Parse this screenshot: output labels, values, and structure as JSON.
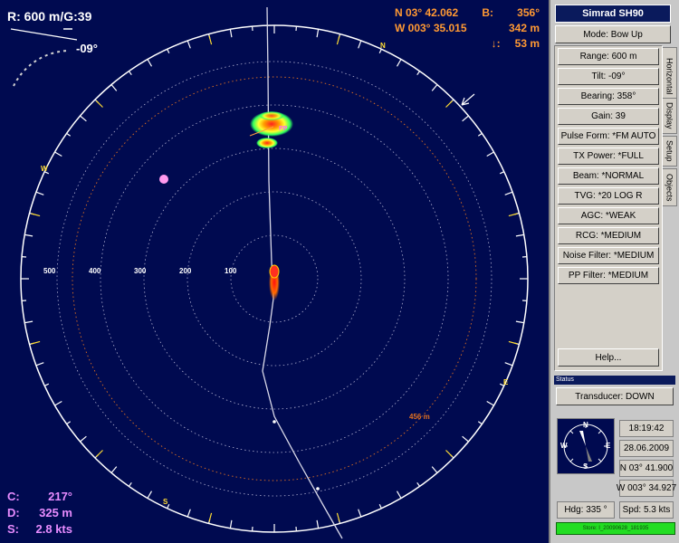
{
  "display": {
    "range_text": "R:  600 m/G:39",
    "tilt_text": "-09°",
    "position": {
      "lat": "N  03° 42.062",
      "bearing_label": "B:",
      "bearing_value": "356°",
      "lon": "W 003° 35.015",
      "distance_value": "342 m",
      "depth_symbol": "↓:",
      "depth_value": "53 m"
    },
    "course": [
      {
        "label": "C:",
        "value": "217°"
      },
      {
        "label": "D:",
        "value": "325 m"
      },
      {
        "label": "S:",
        "value": "2.8 kts"
      }
    ],
    "range_labels": [
      "500",
      "400",
      "300",
      "200",
      "100"
    ],
    "compass_labels": {
      "n": "N",
      "e": "E",
      "s": "S",
      "w": "W"
    },
    "target_distance": "456 m",
    "target_marker": "PP",
    "colors": {
      "background": "#000a50",
      "ring": "#ffffff",
      "position_text": "#ff9933",
      "course_text": "#e88cff",
      "tick": "#ffdd33"
    }
  },
  "panel": {
    "title": "Simrad SH90",
    "mode_button": "Mode: Bow Up",
    "menu_items": [
      "Range: 600 m",
      "Tilt: -09°",
      "Bearing: 358°",
      "Gain: 39",
      "Pulse Form: *FM AUTO",
      "TX Power: *FULL",
      "Beam: *NORMAL",
      "TVG: *20 LOG R",
      "AGC: *WEAK",
      "RCG: *MEDIUM",
      "Noise Filter: *MEDIUM",
      "PP Filter: *MEDIUM"
    ],
    "help_button": "Help...",
    "tabs": [
      "Horizontal",
      "Display",
      "Setup",
      "Objects"
    ],
    "status_label": "Status",
    "transducer_button": "Transducer: DOWN",
    "time": "18:19:42",
    "date": "28.06.2009",
    "lat": "N 03° 41.900",
    "lon": "W 003° 34.927",
    "compass_labels": {
      "n": "N",
      "e": "E",
      "s": "S",
      "w": "W"
    },
    "heading": "Hdg: 335 °",
    "speed": "Spd: 5.3 kts",
    "store_text": "Store: I_20090628_181935"
  }
}
